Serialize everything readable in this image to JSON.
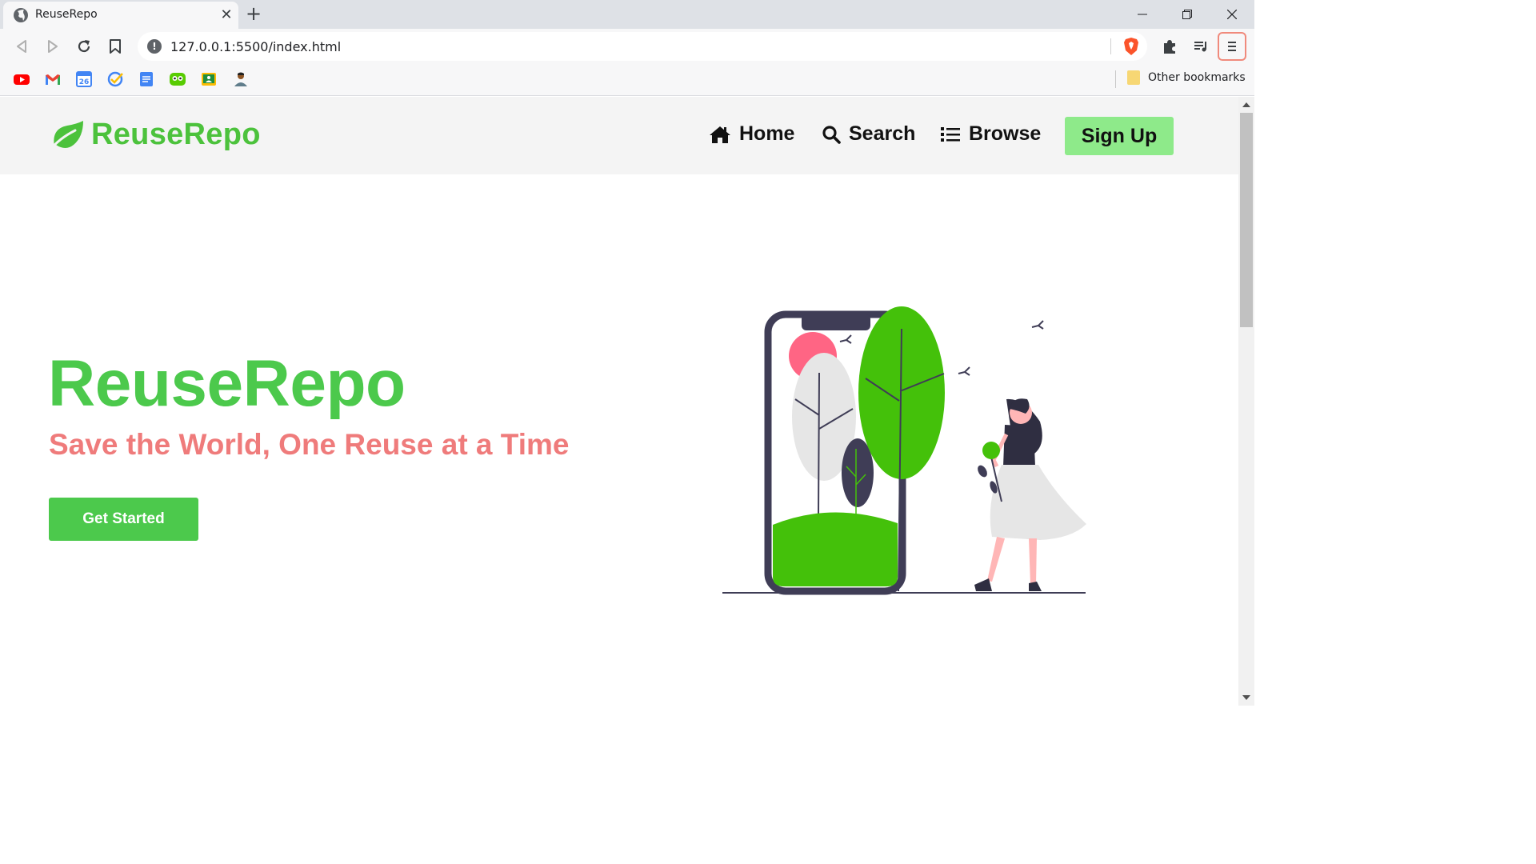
{
  "browser": {
    "tab_title": "ReuseRepo",
    "url": "127.0.0.1:5500/index.html",
    "other_bookmarks_label": "Other bookmarks",
    "bookmarks": [
      {
        "icon": "youtube-icon",
        "color": "#ff0000"
      },
      {
        "icon": "gmail-icon",
        "color": "#ea4335"
      },
      {
        "icon": "google-calendar-icon",
        "color": "#4285f4",
        "text": "26"
      },
      {
        "icon": "google-tasks-icon",
        "color": "#4285f4"
      },
      {
        "icon": "google-docs-icon",
        "color": "#4285f4"
      },
      {
        "icon": "duolingo-icon",
        "color": "#58cc02"
      },
      {
        "icon": "google-classroom-icon",
        "color": "#fbbc04"
      },
      {
        "icon": "profile-avatar-icon",
        "color": "#8d5524"
      }
    ]
  },
  "site": {
    "brand": "ReuseRepo",
    "nav": {
      "home": "Home",
      "search": "Search",
      "browse": "Browse",
      "signup": "Sign Up"
    },
    "hero": {
      "title": "ReuseRepo",
      "subtitle": "Save the World, One Reuse at a Time",
      "cta": "Get Started"
    },
    "colors": {
      "brand_green": "#4cc23c",
      "hero_green": "#4cc94c",
      "subtitle_pink": "#ef7b7b",
      "signup_bg": "#8eea8a",
      "nav_bg": "#f4f4f4",
      "illustration_green": "#44c10a",
      "illustration_dark": "#3f3d56",
      "illustration_pink": "#ff6584"
    }
  }
}
